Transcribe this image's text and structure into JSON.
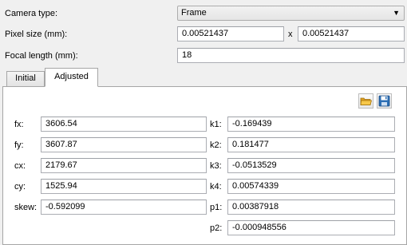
{
  "camera_type": {
    "label": "Camera type:",
    "value": "Frame"
  },
  "pixel_size": {
    "label": "Pixel size (mm):",
    "x_value": "0.00521437",
    "separator": "x",
    "y_value": "0.00521437"
  },
  "focal_length": {
    "label": "Focal length (mm):",
    "value": "18"
  },
  "tabs": [
    {
      "label": "Initial",
      "active": false
    },
    {
      "label": "Adjusted",
      "active": true
    }
  ],
  "toolbar": {
    "icons": [
      "open-folder-icon",
      "save-disk-icon"
    ]
  },
  "params_left": [
    {
      "label": "fx:",
      "value": "3606.54"
    },
    {
      "label": "fy:",
      "value": "3607.87"
    },
    {
      "label": "cx:",
      "value": "2179.67"
    },
    {
      "label": "cy:",
      "value": "1525.94"
    },
    {
      "label": "skew:",
      "value": "-0.592099"
    }
  ],
  "params_right": [
    {
      "label": "k1:",
      "value": "-0.169439"
    },
    {
      "label": "k2:",
      "value": "0.181477"
    },
    {
      "label": "k3:",
      "value": "-0.0513529"
    },
    {
      "label": "k4:",
      "value": "0.00574339"
    },
    {
      "label": "p1:",
      "value": "0.00387918"
    },
    {
      "label": "p2:",
      "value": "-0.000948556"
    }
  ],
  "colors": {
    "folder": "#f0b429",
    "disk": "#2d6fb5",
    "border": "#abadb3"
  }
}
